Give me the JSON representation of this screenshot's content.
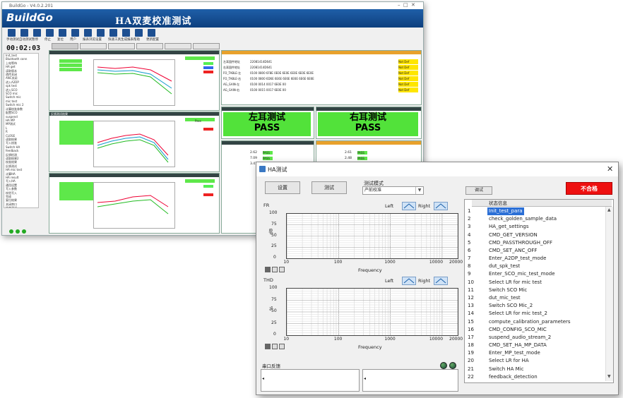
{
  "back_window": {
    "titlebar": "BuildGo - V4.0.2.201",
    "logo": "BuildGo",
    "title": "HA双麦校准测试",
    "toolbar": [
      "手动测试",
      "自动测试",
      "暂停",
      "停止",
      "复位",
      "用户",
      "报表浏览",
      "设置",
      "快速工具",
      "生成报表",
      "帮助",
      "更新配置"
    ],
    "timer": "00:02:03",
    "sidebar_items": [
      "Init_test",
      "Bluetooth conn",
      "上电等待",
      "HA get",
      "读取版本",
      "透传关闭",
      "ANC关闭",
      "进入A2DP",
      "spk test",
      "进入SCO",
      "SCO mic",
      "Switch mic",
      "mic test",
      "Switch mic 2",
      "计算校准参数",
      "配置SCO",
      "suspend",
      "HA MP",
      "MP测试",
      "L",
      "R",
      "CLOSE",
      "读取结果",
      "写入校准",
      "Switch HA",
      "feedback",
      "反馈检测",
      "读取结果2",
      "校准结果",
      "反馈测试",
      "HA mic test",
      "计算HA",
      "HA result",
      "写入HA",
      "通用设置",
      "写入参数",
      "校验写入",
      "完成",
      "复位结果",
      "关闭串口",
      "结束测试"
    ],
    "fb_title": "反馈测试结果",
    "pass_label": "Pass",
    "left_result": "左耳测试",
    "right_result": "右耳测试",
    "pass": "PASS",
    "info_rows": [
      {
        "k": "左耳固件地址",
        "v": "22081414D641",
        "r": "Not Def"
      },
      {
        "k": "右耳固件地址",
        "v": "22081414D641",
        "r": "Not Def"
      },
      {
        "k": "FO_TABLE-左",
        "v": "0100 0800 6F8E 0E0E 6E0E 6E0E 6E0E 6E0E",
        "r": "Not Def"
      },
      {
        "k": "FO_TABLE-右",
        "v": "0100 0800 6D6E 6E6E 6E6E 6E6E 6E6E 6E6E",
        "r": "Not Def"
      },
      {
        "k": "AG_GAIN-左",
        "v": "0100 0014 0017 6E0E 00",
        "r": "Not Def"
      },
      {
        "k": "AG_GAIN-右",
        "v": "0100 0015 0017 6E0E 00",
        "r": "Not Def"
      }
    ],
    "left_values": [
      "2.62",
      "7.09",
      "3.41"
    ],
    "right_values": [
      "2.61",
      "2.48",
      "5.33"
    ]
  },
  "dialog": {
    "title": "HA测试",
    "setup_button": "设置",
    "test_button": "测试",
    "mode_label": "测试模式",
    "mode_value": "产前校准",
    "debug_button": "调试",
    "fail_badge": "不合格",
    "fr_plot": {
      "title": "FR",
      "ylabel": "dB",
      "xlabel": "Frequency",
      "legend_left": "Left",
      "legend_right": "Right",
      "yticks": [
        "100",
        "75",
        "50",
        "25",
        "0"
      ],
      "xticks": [
        "10",
        "100",
        "1000",
        "10000",
        "20000"
      ]
    },
    "thd_plot": {
      "title": "THD",
      "ylabel": "%",
      "xlabel": "Frequency",
      "legend_left": "Left",
      "legend_right": "Right",
      "yticks": [
        "100",
        "75",
        "50",
        "25",
        "0"
      ],
      "xticks": [
        "10",
        "100",
        "1000",
        "10000",
        "20000"
      ]
    },
    "serial_label": "串口反馈",
    "status_header": "状态信息",
    "status_items": [
      "Init_test_para",
      "check_golden_sample_data",
      "HA_get_settings",
      "CMD_GET_VERSION",
      "CMD_PASSTHROUGH_OFF",
      "CMD_SET_ANC_OFF",
      "Enter_A2DP_test_mode",
      "dut_spk_test",
      "Enter_SCO_mic_test_mode",
      "Select LR for mic test",
      "Switch SCO Mic",
      "dut_mic_test",
      "Switch SCO Mic_2",
      "Select LR for mic test_2",
      "compute_calibration_parameters",
      "CMD_CONFIG_SCO_MIC",
      "suspend_audio_stream_2",
      "CMD_SET_HA_MP_DATA",
      "Enter_MP_test_mode",
      "Select LR for HA",
      "Switch HA Mic",
      "feedback_detection"
    ],
    "status_indices": [
      "1",
      "2",
      "3",
      "4",
      "5",
      "6",
      "7",
      "8",
      "9",
      "10",
      "11",
      "12",
      "13",
      "14",
      "15",
      "16",
      "17",
      "18",
      "19",
      "20",
      "21",
      "22"
    ],
    "selected_index": 0
  }
}
